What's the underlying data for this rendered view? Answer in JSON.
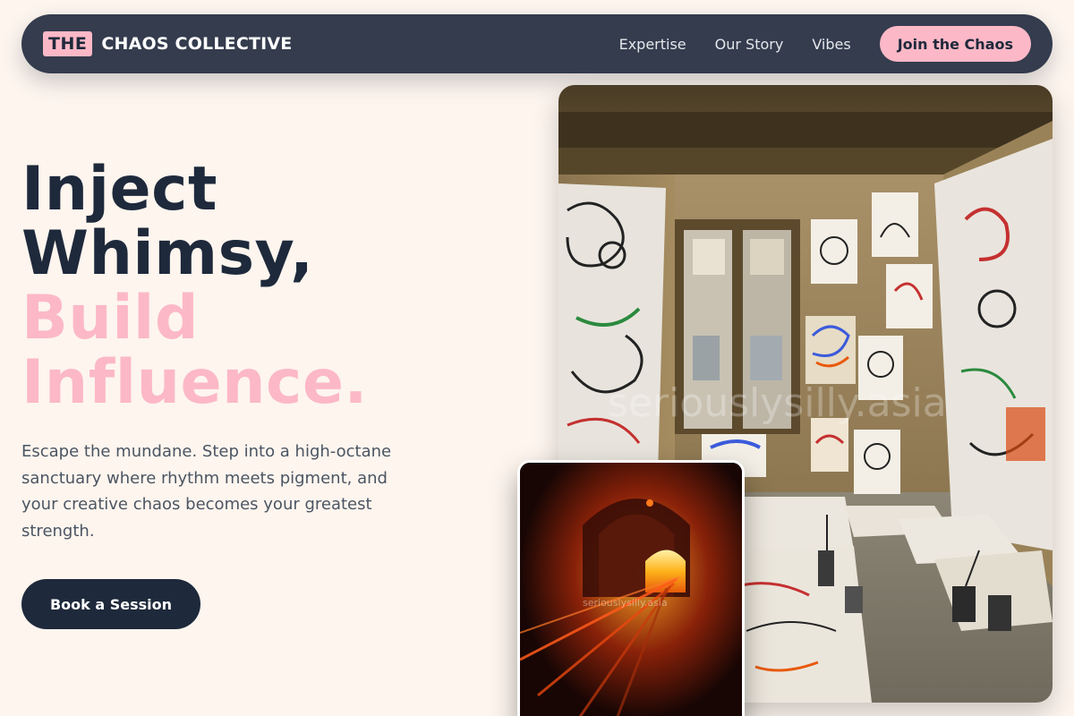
{
  "nav": {
    "logo_the": "THE",
    "logo_name": "CHAOS COLLECTIVE",
    "links": [
      "Expertise",
      "Our Story",
      "Vibes"
    ],
    "cta_label": "Join the Chaos"
  },
  "hero": {
    "title_line1": "Inject",
    "title_line2": "Whimsy,",
    "title_line3": "Build",
    "title_line4": "Influence.",
    "description": "Escape the mundane. Step into a high-octane sanctuary where rhythm meets pigment, and your creative chaos becomes your greatest strength.",
    "book_label": "Book a Session"
  },
  "images": {
    "main": {
      "subject": "art-studio-room",
      "watermark": "seriouslysilly.asia"
    },
    "secondary": {
      "subject": "glowing-furnace",
      "watermark": "seriouslysilly.asia"
    }
  },
  "colors": {
    "background": "#fdf5ee",
    "nav_bg": "#343c4e",
    "accent_pink": "#fcb8c6",
    "dark_navy": "#1e293b",
    "body_text": "#4b5563"
  }
}
